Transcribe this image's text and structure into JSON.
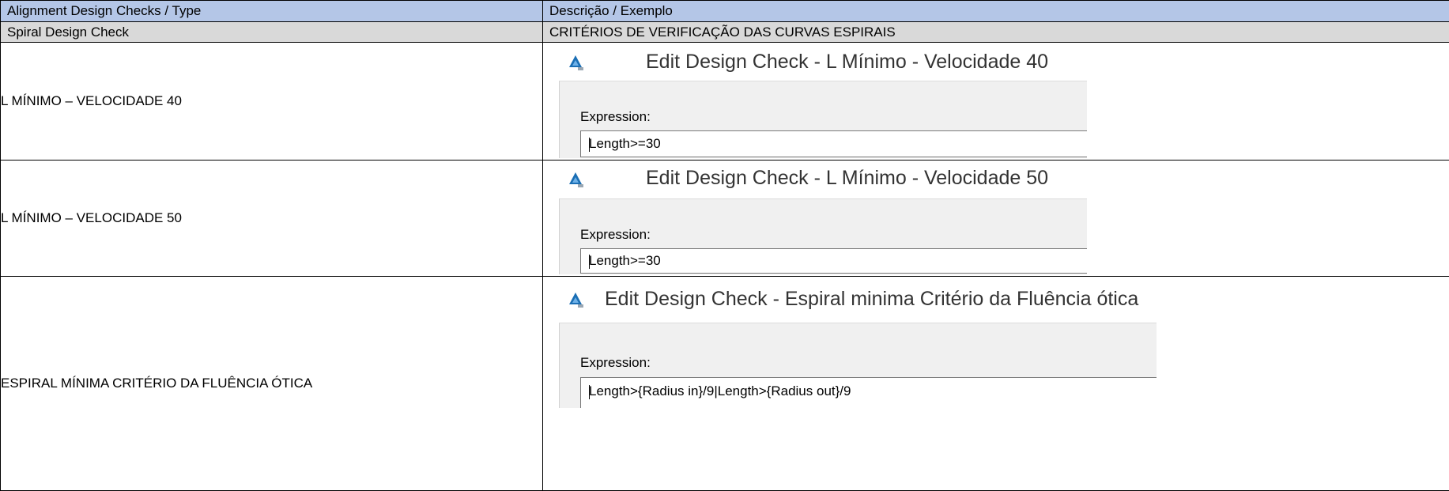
{
  "table": {
    "header": {
      "col1": "Alignment Design Checks / Type",
      "col2": "Descrição / Exemplo"
    },
    "section": {
      "col1": "Spiral Design Check",
      "col2": "CRITÉRIOS DE VERIFICAÇÃO DAS CURVAS ESPIRAIS"
    },
    "rows": [
      {
        "label": "L MÍNIMO – VELOCIDADE 40",
        "dialog": {
          "title": "Edit Design Check - L Mínimo - Velocidade 40",
          "expression_label": "Expression:",
          "expression_value": "Length>=30",
          "icon": "autodesk-civil3d-icon"
        }
      },
      {
        "label": "L MÍNIMO – VELOCIDADE 50",
        "dialog": {
          "title": "Edit Design Check - L Mínimo - Velocidade 50",
          "expression_label": "Expression:",
          "expression_value": "Length>=30",
          "icon": "autodesk-civil3d-icon"
        }
      },
      {
        "label": "ESPIRAL MÍNIMA CRITÉRIO DA FLUÊNCIA ÓTICA",
        "dialog": {
          "title": "Edit Design Check - Espiral minima Critério da Fluência ótica",
          "expression_label": "Expression:",
          "expression_value": "Length>{Radius in}/9|Length>{Radius out}/9",
          "icon": "autodesk-civil3d-icon"
        }
      }
    ]
  },
  "colors": {
    "header_bg": "#b4c6e7",
    "section_bg": "#d9d9d9",
    "icon_blue": "#1b6fb5"
  }
}
